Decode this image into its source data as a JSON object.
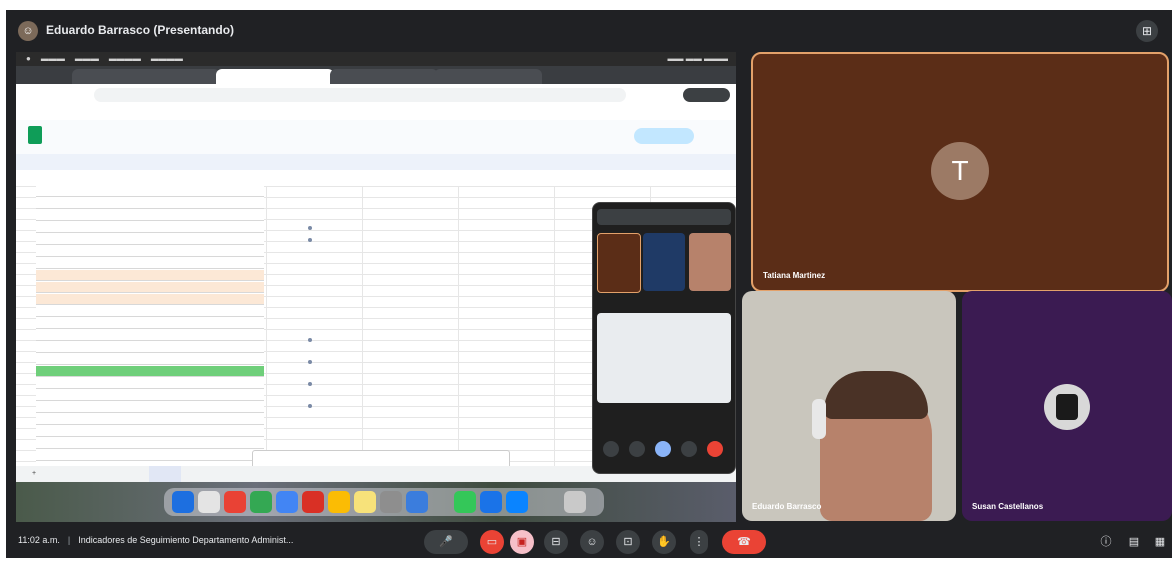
{
  "meeting": {
    "presenter_label": "Eduardo Barrasco (Presentando)",
    "time": "11:02 a.m.",
    "meeting_title": "Indicadores de Seguimiento Departamento Administ..."
  },
  "participants": [
    {
      "name": "Tatiana Martinez",
      "initial": "T"
    },
    {
      "name": "Eduardo Barrasco"
    },
    {
      "name": "Susan Castellanos"
    }
  ],
  "icons": {
    "presenter": "avatar-icon",
    "layout": "layout-icon",
    "mic": "mic-icon",
    "camera": "camera-off-icon",
    "present": "present-icon",
    "captions": "captions-icon",
    "emoji": "emoji-icon",
    "more": "more-icon",
    "hand": "raise-hand-icon",
    "leave": "end-call-icon",
    "info": "info-icon",
    "chat": "chat-icon",
    "activities": "activities-icon"
  },
  "colors": {
    "meet_bg": "#202124",
    "tatiana_tile": "#5b2d17",
    "susan_tile": "#3b1b52",
    "end_call": "#ea4335",
    "sheets_green": "#0f9d58"
  }
}
